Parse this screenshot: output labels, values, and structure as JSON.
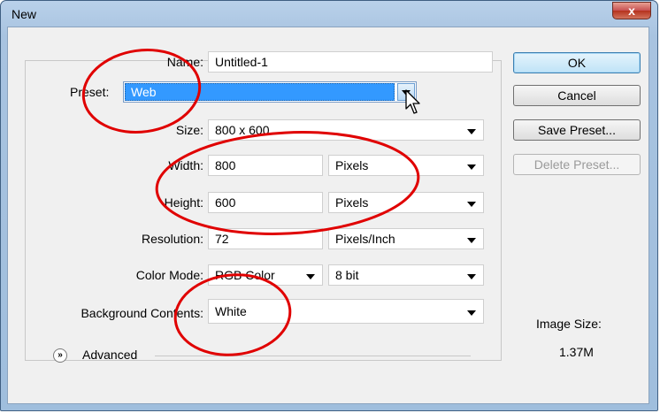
{
  "window": {
    "title": "New",
    "close_glyph": "x"
  },
  "form": {
    "name": {
      "label": "Name:",
      "value": "Untitled-1"
    },
    "preset": {
      "label": "Preset:",
      "value": "Web"
    },
    "size": {
      "label": "Size:",
      "value": "800 x 600"
    },
    "width": {
      "label": "Width:",
      "value": "800",
      "unit": "Pixels"
    },
    "height": {
      "label": "Height:",
      "value": "600",
      "unit": "Pixels"
    },
    "resolution": {
      "label": "Resolution:",
      "value": "72",
      "unit": "Pixels/Inch"
    },
    "color_mode": {
      "label": "Color Mode:",
      "value": "RGB Color",
      "depth": "8 bit"
    },
    "background": {
      "label": "Background Contents:",
      "value": "White"
    },
    "advanced": {
      "label": "Advanced",
      "glyph": "»"
    }
  },
  "buttons": {
    "ok": "OK",
    "cancel": "Cancel",
    "save_preset": "Save Preset...",
    "delete_preset": "Delete Preset..."
  },
  "image_size": {
    "label": "Image Size:",
    "value": "1.37M"
  },
  "icons": {
    "close": "close-icon",
    "dropdown": "chevron-down-icon",
    "cursor": "mouse-pointer-icon",
    "expand": "expand-icon"
  },
  "colors": {
    "selection": "#3399ff",
    "annotation": "#e00000",
    "ok_button": "#bfe3f7"
  }
}
